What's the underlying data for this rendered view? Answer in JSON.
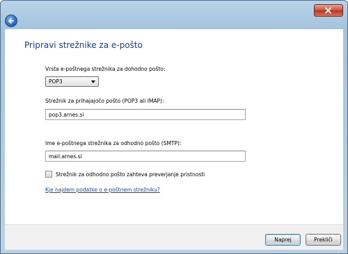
{
  "window": {
    "title": ""
  },
  "heading": "Pripravi strežnike za e-pošto",
  "server_type": {
    "label": "Vrsta e-poštnega strežnika za dohodno pošto:",
    "selected": "POP3"
  },
  "incoming": {
    "label": "Strežnik za prihajajočo pošto (POP3 ali IMAP):",
    "value": "pop3.arnes.si"
  },
  "outgoing": {
    "label": "Ime e-poštnega strežnika za odhodno pošto (SMTP):",
    "value": "mail.arnes.si"
  },
  "auth_checkbox": {
    "label": "Strežnik za odhodno pošto zahteva preverjanje pristnosti",
    "checked": false
  },
  "help_link": "Kje najdem podatke o e-poštnem strežniku?",
  "buttons": {
    "next": "Naprej",
    "cancel": "Prekliči"
  }
}
